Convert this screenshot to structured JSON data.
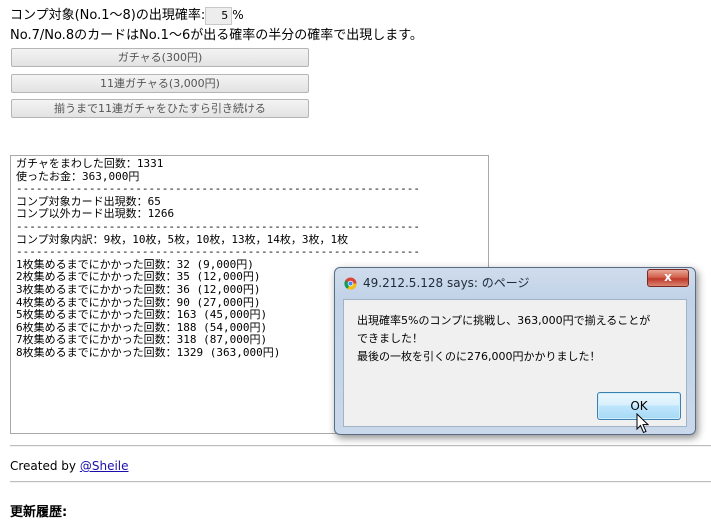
{
  "rate": {
    "label": "コンプ対象(No.1〜8)の出現確率:",
    "value": "5",
    "unit": "%"
  },
  "note": "No.7/No.8のカードはNo.1〜6が出る確率の半分の確率で出現します。",
  "buttons": {
    "gacha": "ガチャる(300円)",
    "gacha11": "11連ガチャる(3,000円)",
    "gacha_until": "揃うまで11連ガチャをひたすら引き続ける"
  },
  "result": {
    "lines": [
      "ガチャをまわした回数：1331",
      "使ったお金：363,000円",
      "-------------------------------------------------------------",
      "コンプ対象カード出現数：65",
      "コンプ以外カード出現数：1266",
      "-------------------------------------------------------------",
      "コンプ対象内訳：9枚，10枚，5枚，10枚，13枚，14枚，3枚，1枚",
      "-------------------------------------------------------------",
      "1枚集めるまでにかかった回数：32 (9,000円)",
      "2枚集めるまでにかかった回数：35 (12,000円)",
      "3枚集めるまでにかかった回数：36 (12,000円)",
      "4枚集めるまでにかかった回数：90 (27,000円)",
      "5枚集めるまでにかかった回数：163 (45,000円)",
      "6枚集めるまでにかかった回数：188 (54,000円)",
      "7枚集めるまでにかかった回数：318 (87,000円)",
      "8枚集めるまでにかかった回数：1329 (363,000円)"
    ]
  },
  "credit": {
    "prefix": "Created by ",
    "link": "@Sheile"
  },
  "history_heading": "更新履歴:",
  "dialog": {
    "title": "49.212.5.128 says: のページ",
    "close": "x",
    "message_lines": [
      "出現確率5%のコンプに挑戦し、363,000円で揃えることが",
      "できました！",
      "最後の一枚を引くのに276,000円かかりました！"
    ],
    "ok": "OK"
  },
  "colors": {
    "link": "#1a0dab",
    "close_button": "#c0392b",
    "dialog_frame": "#c2d3e8"
  }
}
